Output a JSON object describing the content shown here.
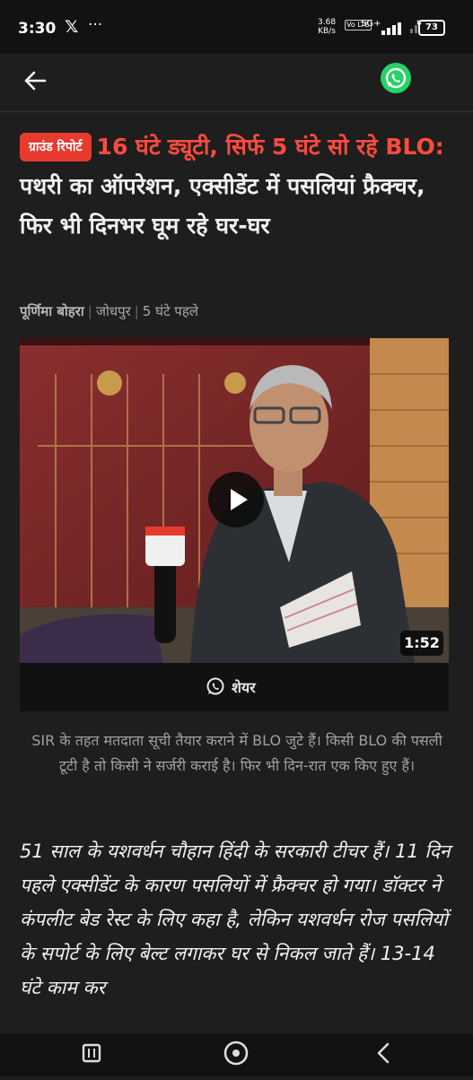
{
  "status_bar": {
    "time": "3:30",
    "network_speed": "3.68",
    "speed_unit": "KB/s",
    "volte": "Vo LTE",
    "signal": "5G+",
    "battery": "73"
  },
  "icons": {
    "back": "arrow-left",
    "whatsapp": "whatsapp",
    "play": "play",
    "share": "whatsapp"
  },
  "colors": {
    "accent_red": "#e63b2e",
    "whatsapp_green": "#25d366"
  },
  "article": {
    "badge": "ग्राउंड रिपोर्ट",
    "headline_highlight": "16 घंटे ड्यूटी, सिर्फ 5 घंटे सो रहे BLO:",
    "headline_rest": "पथरी का ऑपरेशन, एक्सीडेंट में पसलियां फ्रैक्चर, फिर भी दिनभर घूम रहे घर-घर",
    "author": "पूर्णिमा बोहरा",
    "location": "जोधपुर",
    "time_ago": "5 घंटे पहले",
    "video_duration": "1:52",
    "share_label": "शेयर",
    "caption": "SIR के तहत मतदाता सूची तैयार कराने में BLO जुटे हैं। किसी BLO की पसली टूटी है तो किसी ने सर्जरी कराई है। फिर भी दिन-रात एक किए हुए हैं।",
    "body_text": "51 साल के यशवर्धन चौहान हिंदी के सरकारी टीचर हैं। 11 दिन पहले एक्सीडेंट के कारण पसलियों में फ्रैक्चर हो गया। डॉक्टर ने कंपलीट बेड रेस्ट के लिए कहा है, लेकिन यशवर्धन रोज पसलियों के सपोर्ट के लिए बेल्ट लगाकर घर से निकल जाते हैं। 13-14 घंटे काम कर"
  }
}
